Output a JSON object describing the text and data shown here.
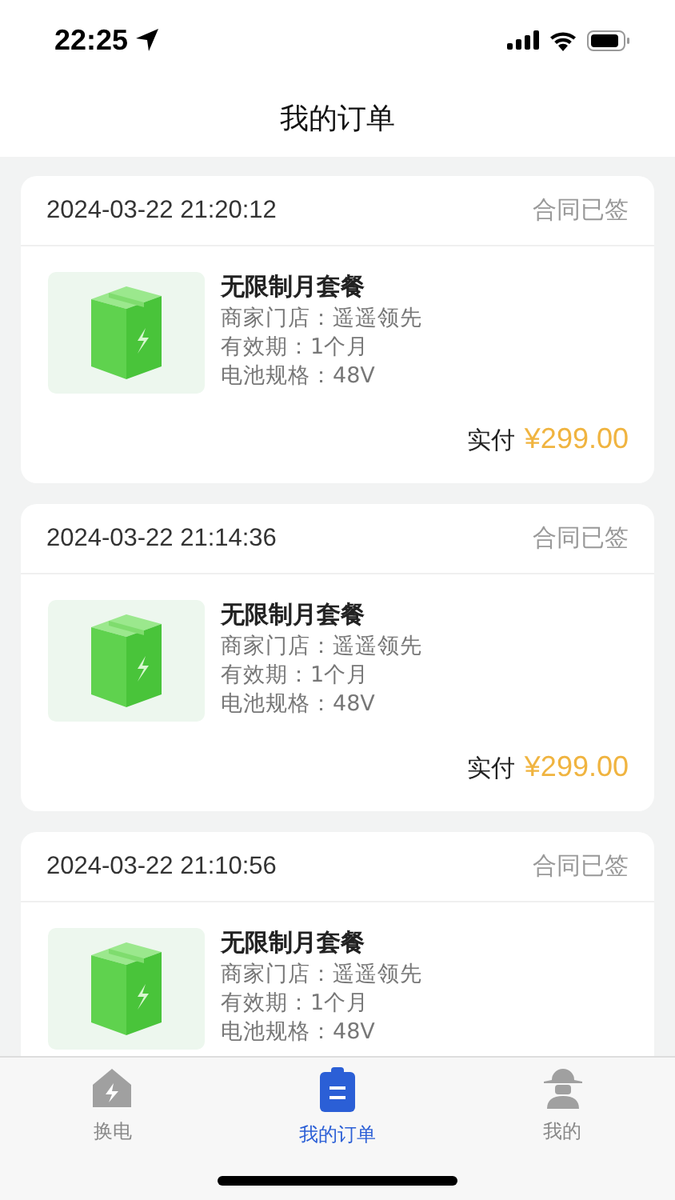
{
  "status_bar": {
    "time": "22:25"
  },
  "header": {
    "title": "我的订单"
  },
  "orders": [
    {
      "date": "2024-03-22 21:20:12",
      "status": "合同已签",
      "name": "无限制月套餐",
      "details": [
        "商家门店：遥遥领先",
        "有效期：1个月",
        "电池规格：48V"
      ],
      "paid_label": "实付",
      "amount": "¥299.00"
    },
    {
      "date": "2024-03-22 21:14:36",
      "status": "合同已签",
      "name": "无限制月套餐",
      "details": [
        "商家门店：遥遥领先",
        "有效期：1个月",
        "电池规格：48V"
      ],
      "paid_label": "实付",
      "amount": "¥299.00"
    },
    {
      "date": "2024-03-22 21:10:56",
      "status": "合同已签",
      "name": "无限制月套餐",
      "details": [
        "商家门店：遥遥领先",
        "有效期：1个月",
        "电池规格：48V"
      ]
    }
  ],
  "tab_bar": [
    {
      "label": "换电",
      "kind": "swap",
      "selected": false
    },
    {
      "label": "我的订单",
      "kind": "orders",
      "selected": true
    },
    {
      "label": "我的",
      "kind": "profile",
      "selected": false
    }
  ]
}
